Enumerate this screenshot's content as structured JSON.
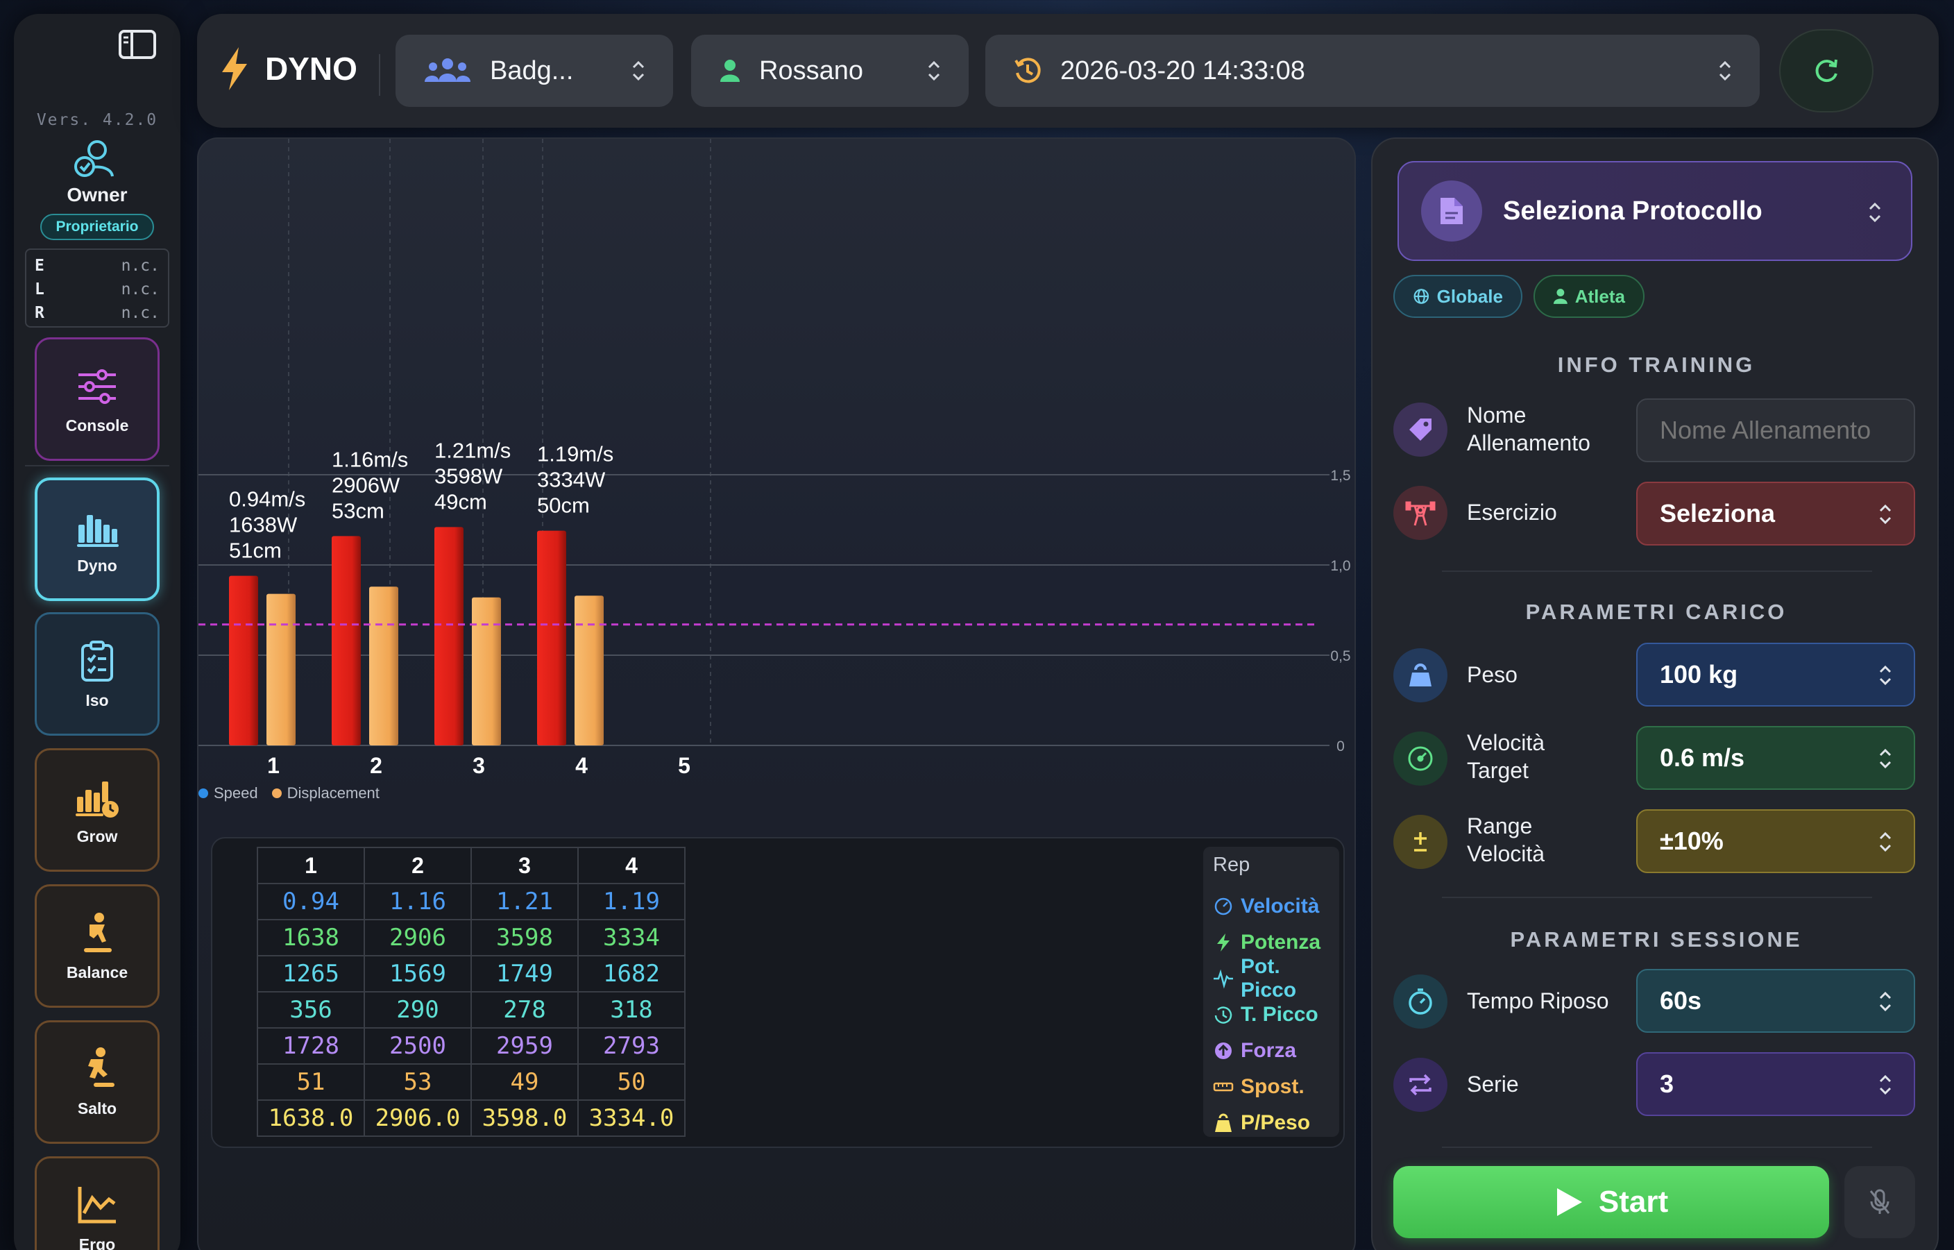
{
  "sidebar": {
    "version": "Vers. 4.2.0",
    "user": {
      "name": "Owner",
      "role": "Proprietario"
    },
    "elr": [
      {
        "key": "E",
        "value": "n.c."
      },
      {
        "key": "L",
        "value": "n.c."
      },
      {
        "key": "R",
        "value": "n.c."
      }
    ],
    "items": [
      {
        "label": "Console",
        "icon": "sliders-icon"
      },
      {
        "label": "Dyno",
        "icon": "bar-chart-icon",
        "active": true
      },
      {
        "label": "Iso",
        "icon": "clipboard-icon"
      },
      {
        "label": "Grow",
        "icon": "growth-chart-icon"
      },
      {
        "label": "Balance",
        "icon": "balance-icon"
      },
      {
        "label": "Salto",
        "icon": "jump-icon"
      },
      {
        "label": "Ergo",
        "icon": "trend-chart-icon"
      }
    ]
  },
  "topbar": {
    "app_name": "DYNO",
    "group": "Badg...",
    "athlete": "Rossano",
    "session_datetime": "2026-03-20 14:33:08"
  },
  "chart_data": {
    "type": "bar",
    "categories": [
      "1",
      "2",
      "3",
      "4",
      "5"
    ],
    "series": [
      {
        "name": "Speed",
        "color": "#e0211a",
        "values": [
          0.94,
          1.16,
          1.21,
          1.19,
          null
        ]
      },
      {
        "name": "Displacement",
        "color": "#f3ac5e",
        "values": [
          0.84,
          0.88,
          0.82,
          0.83,
          null
        ]
      }
    ],
    "bar_labels": [
      [
        "0.94m/s",
        "1638W",
        "51cm"
      ],
      [
        "1.16m/s",
        "2906W",
        "53cm"
      ],
      [
        "1.21m/s",
        "3598W",
        "49cm"
      ],
      [
        "1.19m/s",
        "3334W",
        "50cm"
      ]
    ],
    "y_ticks": [
      "0",
      "0,5",
      "1,0",
      "1,5"
    ],
    "ylim": [
      0,
      1.5
    ],
    "target_line": 0.67,
    "target_line_color": "#c43ccf",
    "legend_position": "bottom-left",
    "grid": true
  },
  "table": {
    "headers": [
      "1",
      "2",
      "3",
      "4"
    ],
    "rows": [
      {
        "color": "#4d9cf5",
        "values": [
          "0.94",
          "1.16",
          "1.21",
          "1.19"
        ]
      },
      {
        "color": "#68e07a",
        "values": [
          "1638",
          "2906",
          "3598",
          "3334"
        ]
      },
      {
        "color": "#5fd6ea",
        "values": [
          "1265",
          "1569",
          "1749",
          "1682"
        ]
      },
      {
        "color": "#5fe0d4",
        "values": [
          "356",
          "290",
          "278",
          "318"
        ]
      },
      {
        "color": "#b58cf5",
        "values": [
          "1728",
          "2500",
          "2959",
          "2793"
        ]
      },
      {
        "color": "#f5b85a",
        "values": [
          "51",
          "53",
          "49",
          "50"
        ]
      },
      {
        "color": "#f7e36a",
        "values": [
          "1638.0",
          "2906.0",
          "3598.0",
          "3334.0"
        ]
      }
    ],
    "rep_title": "Rep",
    "rep_labels": [
      {
        "label": "Velocità",
        "color": "#4d9cf5",
        "icon": "speedometer-icon"
      },
      {
        "label": "Potenza",
        "color": "#68e07a",
        "icon": "lightning-icon"
      },
      {
        "label": "Pot. Picco",
        "color": "#5fd6ea",
        "icon": "pulse-icon"
      },
      {
        "label": "T. Picco",
        "color": "#5fe0d4",
        "icon": "timer-icon"
      },
      {
        "label": "Forza",
        "color": "#b58cf5",
        "icon": "arrow-up-circle-icon"
      },
      {
        "label": "Spost.",
        "color": "#f5b85a",
        "icon": "ruler-icon"
      },
      {
        "label": "P/Peso",
        "color": "#f7e36a",
        "icon": "weight-icon"
      }
    ]
  },
  "right_panel": {
    "protocol_label": "Seleziona Protocollo",
    "chip_global": "Globale",
    "chip_athlete": "Atleta",
    "info_title": "INFO TRAINING",
    "nome_label_1": "Nome",
    "nome_label_2": "Allenamento",
    "nome_placeholder": "Nome Allenamento",
    "esercizio_label": "Esercizio",
    "esercizio_value": "Seleziona",
    "carico_title": "PARAMETRI CARICO",
    "peso_label": "Peso",
    "peso_value": "100 kg",
    "vel_label_1": "Velocità",
    "vel_label_2": "Target",
    "vel_value": "0.6 m/s",
    "range_label_1": "Range",
    "range_label_2": "Velocità",
    "range_value": "±10%",
    "sessione_title": "PARAMETRI SESSIONE",
    "riposo_label": "Tempo Riposo",
    "riposo_value": "60s",
    "serie_label": "Serie",
    "serie_value": "3",
    "start_label": "Start"
  }
}
